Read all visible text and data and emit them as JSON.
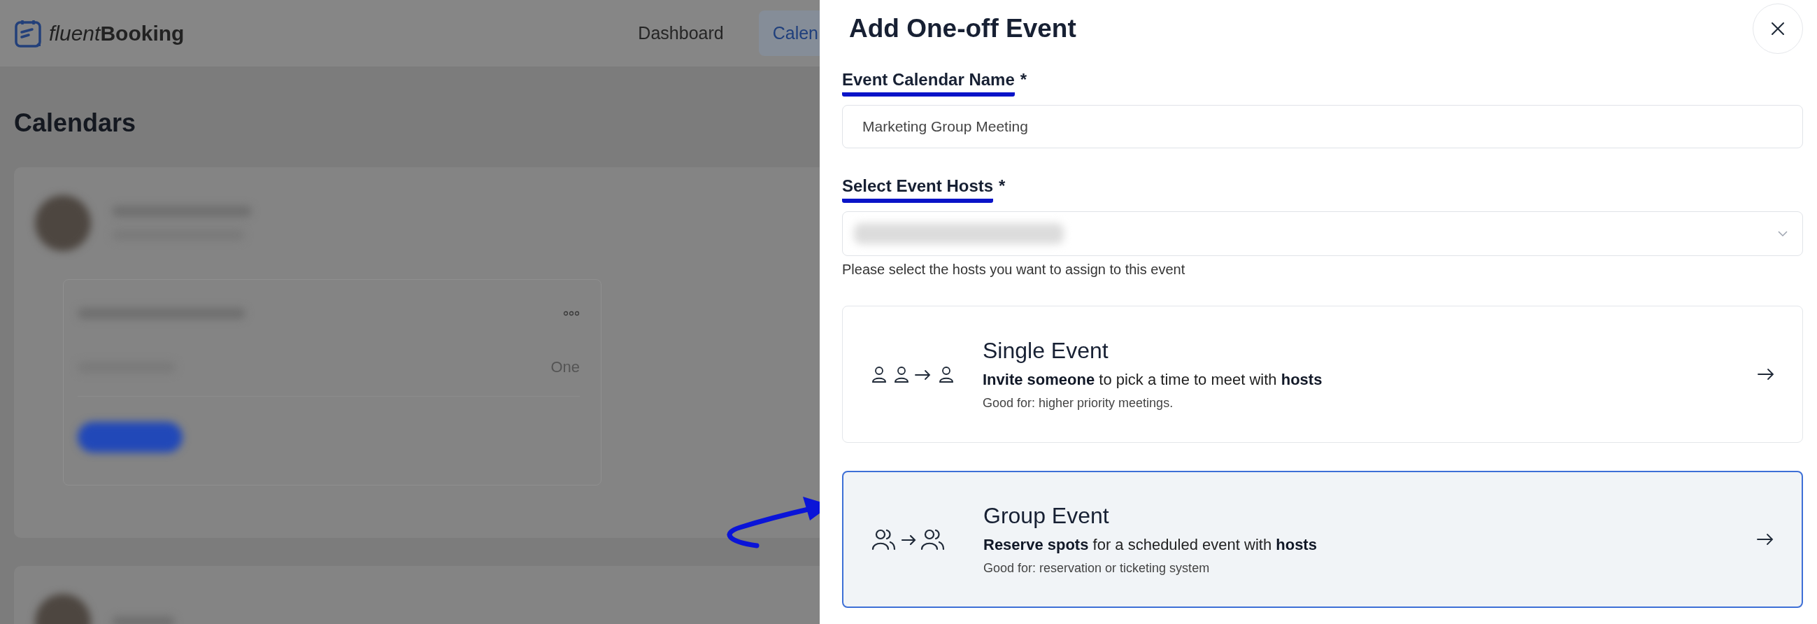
{
  "app": {
    "logo_light": "fluent",
    "logo_bold": "Booking"
  },
  "nav": [
    {
      "label": "Dashboard",
      "selected": false
    },
    {
      "label": "Calen",
      "selected": true
    }
  ],
  "page_title": "Calendars",
  "background_card": {
    "cut_text": "One"
  },
  "drawer": {
    "title": "Add One-off Event",
    "fields": [
      {
        "kind": "text",
        "label": "Event Calendar Name",
        "required_mark": "*",
        "underlined": true,
        "value": "Marketing Group Meeting"
      },
      {
        "kind": "select",
        "label": "Select Event Hosts",
        "required_mark": "*",
        "underlined": true,
        "help": "Please select the hosts you want to assign to this event"
      }
    ],
    "options": [
      {
        "kind": "single",
        "title": "Single Event",
        "description": "**Invite someone** to pick a time to meet with **hosts**",
        "note": "Good for: higher priority meetings.",
        "selected": false
      },
      {
        "kind": "group",
        "title": "Group Event",
        "description": "**Reserve spots** for a scheduled event with **hosts**",
        "note": "Good for: reservation or ticketing system",
        "selected": true
      }
    ]
  }
}
